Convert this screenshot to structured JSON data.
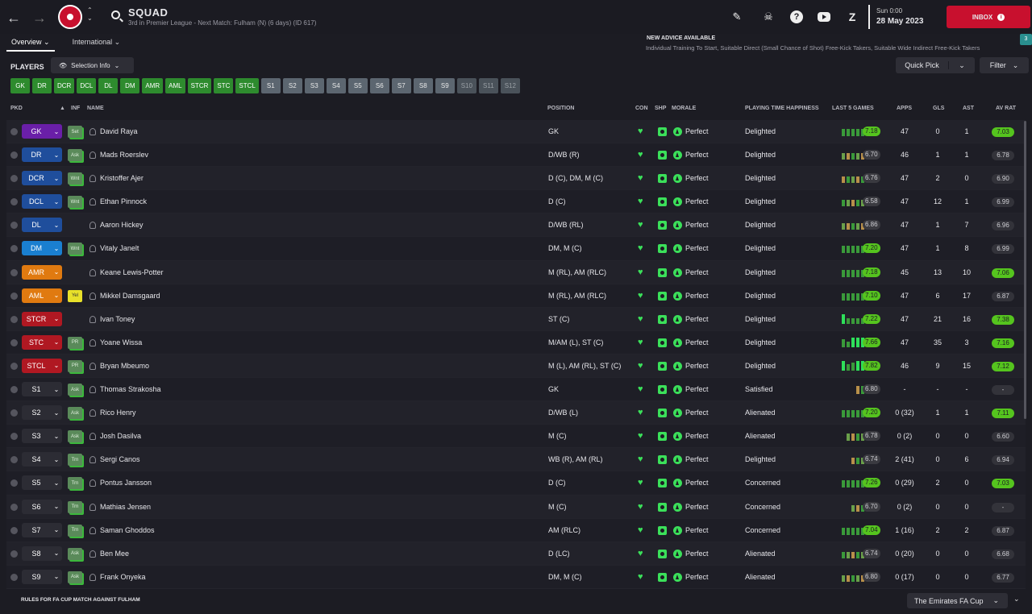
{
  "header": {
    "title": "SQUAD",
    "subtitle": "3rd in Premier League - Next Match: Fulham (N) (6 days) (ID 617)",
    "date_time": "Sun 0:00",
    "date_day": "28 May 2023",
    "inbox_label": "INBOX",
    "inbox_icon": "i"
  },
  "tabs": [
    {
      "label": "Overview ⌄"
    },
    {
      "label": "International ⌄"
    }
  ],
  "advice": {
    "title": "NEW ADVICE AVAILABLE",
    "text": "Individual Training To Start, Suitable Direct (Small Chance of Shot) Free-Kick Takers, Suitable Wide Indirect Free-Kick Takers",
    "count": "3"
  },
  "toolbar": {
    "players_label": "PLAYERS",
    "selection_info": "Selection Info",
    "quick_pick": "Quick Pick",
    "filter": "Filter"
  },
  "position_buttons": [
    "GK",
    "DR",
    "DCR",
    "DCL",
    "DL",
    "DM",
    "AMR",
    "AML",
    "STCR",
    "STC",
    "STCL",
    "S1",
    "S2",
    "S3",
    "S4",
    "S5",
    "S6",
    "S7",
    "S8",
    "S9",
    "S10",
    "S11",
    "S12"
  ],
  "columns": {
    "pkd": "PKD",
    "sort": "▲",
    "inf": "INF",
    "name": "NAME",
    "position": "POSITION",
    "con": "CON",
    "shp": "SHP",
    "morale": "MORALE",
    "happiness": "PLAYING TIME HAPPINESS",
    "last5": "LAST 5 GAMES",
    "apps": "APPS",
    "gls": "GLS",
    "ast": "AST",
    "avrat": "AV RAT"
  },
  "colors": {
    "gk": "#6a1fa8",
    "def": "#1f4e9c",
    "dm": "#1a7fd0",
    "am": "#e07a10",
    "st": "#b01822",
    "sub": "#2c2c34",
    "accent_green": "#55c41e",
    "inbox": "#c8102e"
  },
  "players": [
    {
      "pick": "GK",
      "pick_color": "#6a1fa8",
      "inf": "Set",
      "inf_style": "green",
      "name": "David Raya",
      "position": "GK",
      "morale": "Perfect",
      "happiness": "Delighted",
      "last5": "7.18",
      "last5_hi": true,
      "apps": "47",
      "gls": "0",
      "ast": "1",
      "avrat": "7.03",
      "avrat_hi": true
    },
    {
      "pick": "DR",
      "pick_color": "#1f4e9c",
      "inf": "Ask",
      "inf_style": "green",
      "name": "Mads Roerslev",
      "position": "D/WB (R)",
      "morale": "Perfect",
      "happiness": "Delighted",
      "last5": "6.70",
      "last5_hi": false,
      "apps": "46",
      "gls": "1",
      "ast": "1",
      "avrat": "6.78",
      "avrat_hi": false
    },
    {
      "pick": "DCR",
      "pick_color": "#1f4e9c",
      "inf": "Wnt",
      "inf_style": "green",
      "name": "Kristoffer Ajer",
      "position": "D (C), DM, M (C)",
      "morale": "Perfect",
      "happiness": "Delighted",
      "last5": "6.76",
      "last5_hi": false,
      "apps": "47",
      "gls": "2",
      "ast": "0",
      "avrat": "6.90",
      "avrat_hi": false
    },
    {
      "pick": "DCL",
      "pick_color": "#1f4e9c",
      "inf": "Wnt",
      "inf_style": "green",
      "name": "Ethan Pinnock",
      "position": "D (C)",
      "morale": "Perfect",
      "happiness": "Delighted",
      "last5": "6.58",
      "last5_hi": false,
      "apps": "47",
      "gls": "12",
      "ast": "1",
      "avrat": "6.99",
      "avrat_hi": false
    },
    {
      "pick": "DL",
      "pick_color": "#1f4e9c",
      "inf": "",
      "inf_style": "",
      "name": "Aaron Hickey",
      "position": "D/WB (RL)",
      "morale": "Perfect",
      "happiness": "Delighted",
      "last5": "6.86",
      "last5_hi": false,
      "apps": "47",
      "gls": "1",
      "ast": "7",
      "avrat": "6.96",
      "avrat_hi": false
    },
    {
      "pick": "DM",
      "pick_color": "#1a7fd0",
      "inf": "Wnt",
      "inf_style": "green",
      "name": "Vitaly Janelt",
      "position": "DM, M (C)",
      "morale": "Perfect",
      "happiness": "Delighted",
      "last5": "7.20",
      "last5_hi": true,
      "apps": "47",
      "gls": "1",
      "ast": "8",
      "avrat": "6.99",
      "avrat_hi": false
    },
    {
      "pick": "AMR",
      "pick_color": "#e07a10",
      "inf": "",
      "inf_style": "",
      "name": "Keane Lewis-Potter",
      "position": "M (RL), AM (RLC)",
      "morale": "Perfect",
      "happiness": "Delighted",
      "last5": "7.18",
      "last5_hi": true,
      "apps": "45",
      "gls": "13",
      "ast": "10",
      "avrat": "7.06",
      "avrat_hi": true
    },
    {
      "pick": "AML",
      "pick_color": "#e07a10",
      "inf": "Yel",
      "inf_style": "yel",
      "name": "Mikkel Damsgaard",
      "position": "M (RL), AM (RLC)",
      "morale": "Perfect",
      "happiness": "Delighted",
      "last5": "7.10",
      "last5_hi": true,
      "apps": "47",
      "gls": "6",
      "ast": "17",
      "avrat": "6.87",
      "avrat_hi": false
    },
    {
      "pick": "STCR",
      "pick_color": "#b01822",
      "inf": "",
      "inf_style": "",
      "name": "Ivan Toney",
      "position": "ST (C)",
      "morale": "Perfect",
      "happiness": "Delighted",
      "last5": "7.22",
      "last5_hi": true,
      "apps": "47",
      "gls": "21",
      "ast": "16",
      "avrat": "7.38",
      "avrat_hi": true
    },
    {
      "pick": "STC",
      "pick_color": "#b01822",
      "inf": "PR",
      "inf_style": "green",
      "name": "Yoane Wissa",
      "position": "M/AM (L), ST (C)",
      "morale": "Perfect",
      "happiness": "Delighted",
      "last5": "7.66",
      "last5_hi": true,
      "apps": "47",
      "gls": "35",
      "ast": "3",
      "avrat": "7.16",
      "avrat_hi": true
    },
    {
      "pick": "STCL",
      "pick_color": "#b01822",
      "inf": "PR",
      "inf_style": "green",
      "name": "Bryan Mbeumo",
      "position": "M (L), AM (RL), ST (C)",
      "morale": "Perfect",
      "happiness": "Delighted",
      "last5": "7.82",
      "last5_hi": true,
      "apps": "46",
      "gls": "9",
      "ast": "15",
      "avrat": "7.12",
      "avrat_hi": true
    },
    {
      "pick": "S1",
      "pick_color": "#2c2c34",
      "inf": "Ask",
      "inf_style": "green",
      "name": "Thomas Strakosha",
      "position": "GK",
      "morale": "Perfect",
      "happiness": "Satisfied",
      "last5": "6.80",
      "last5_hi": false,
      "apps": "-",
      "gls": "-",
      "ast": "-",
      "avrat": "-",
      "avrat_hi": false
    },
    {
      "pick": "S2",
      "pick_color": "#2c2c34",
      "inf": "Ask",
      "inf_style": "green",
      "name": "Rico Henry",
      "position": "D/WB (L)",
      "morale": "Perfect",
      "happiness": "Alienated",
      "last5": "7.20",
      "last5_hi": true,
      "apps": "0 (32)",
      "gls": "1",
      "ast": "1",
      "avrat": "7.11",
      "avrat_hi": true
    },
    {
      "pick": "S3",
      "pick_color": "#2c2c34",
      "inf": "Ask",
      "inf_style": "green",
      "name": "Josh Dasilva",
      "position": "M (C)",
      "morale": "Perfect",
      "happiness": "Alienated",
      "last5": "6.78",
      "last5_hi": false,
      "apps": "0 (2)",
      "gls": "0",
      "ast": "0",
      "avrat": "6.60",
      "avrat_hi": false
    },
    {
      "pick": "S4",
      "pick_color": "#2c2c34",
      "inf": "Trn",
      "inf_style": "green",
      "name": "Sergi Canos",
      "position": "WB (R), AM (RL)",
      "morale": "Perfect",
      "happiness": "Delighted",
      "last5": "6.74",
      "last5_hi": false,
      "apps": "2 (41)",
      "gls": "0",
      "ast": "6",
      "avrat": "6.94",
      "avrat_hi": false
    },
    {
      "pick": "S5",
      "pick_color": "#2c2c34",
      "inf": "Trn",
      "inf_style": "green",
      "name": "Pontus Jansson",
      "position": "D (C)",
      "morale": "Perfect",
      "happiness": "Concerned",
      "last5": "7.26",
      "last5_hi": true,
      "apps": "0 (29)",
      "gls": "2",
      "ast": "0",
      "avrat": "7.03",
      "avrat_hi": true
    },
    {
      "pick": "S6",
      "pick_color": "#2c2c34",
      "inf": "Trn",
      "inf_style": "green",
      "name": "Mathias Jensen",
      "position": "M (C)",
      "morale": "Perfect",
      "happiness": "Concerned",
      "last5": "6.70",
      "last5_hi": false,
      "apps": "0 (2)",
      "gls": "0",
      "ast": "0",
      "avrat": "-",
      "avrat_hi": false
    },
    {
      "pick": "S7",
      "pick_color": "#2c2c34",
      "inf": "Trn",
      "inf_style": "green",
      "name": "Saman Ghoddos",
      "position": "AM (RLC)",
      "morale": "Perfect",
      "happiness": "Concerned",
      "last5": "7.04",
      "last5_hi": true,
      "apps": "1 (16)",
      "gls": "2",
      "ast": "2",
      "avrat": "6.87",
      "avrat_hi": false
    },
    {
      "pick": "S8",
      "pick_color": "#2c2c34",
      "inf": "Ask",
      "inf_style": "green",
      "name": "Ben Mee",
      "position": "D (LC)",
      "morale": "Perfect",
      "happiness": "Alienated",
      "last5": "6.74",
      "last5_hi": false,
      "apps": "0 (20)",
      "gls": "0",
      "ast": "0",
      "avrat": "6.68",
      "avrat_hi": false
    },
    {
      "pick": "S9",
      "pick_color": "#2c2c34",
      "inf": "Ask",
      "inf_style": "green",
      "name": "Frank Onyeka",
      "position": "DM, M (C)",
      "morale": "Perfect",
      "happiness": "Alienated",
      "last5": "6.80",
      "last5_hi": false,
      "apps": "0 (17)",
      "gls": "0",
      "ast": "0",
      "avrat": "6.77",
      "avrat_hi": false
    }
  ],
  "footer": {
    "rules_text": "RULES FOR FA CUP MATCH AGAINST FULHAM",
    "competition": "The Emirates FA Cup"
  }
}
